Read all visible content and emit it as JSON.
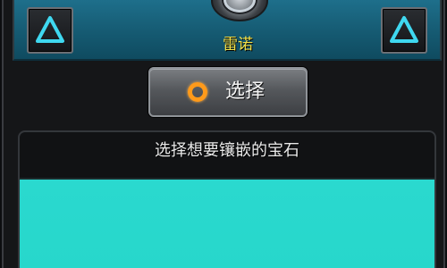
{
  "character": {
    "name": "雷诺",
    "prev_icon": "triangle-up-icon",
    "next_icon": "triangle-up-icon",
    "avatar_icon": "character-avatar"
  },
  "select_button": {
    "label": "选择",
    "icon": "orange-ring-icon"
  },
  "gem_panel": {
    "title": "选择想要镶嵌的宝石",
    "items": []
  },
  "colors": {
    "accent_name": "#f3e24a",
    "panel_top": "#1e6f8b",
    "list_bg": "#2ad9cf",
    "arrow_glow": "#3fd8f0",
    "select_icon": "#ff9a1a"
  }
}
